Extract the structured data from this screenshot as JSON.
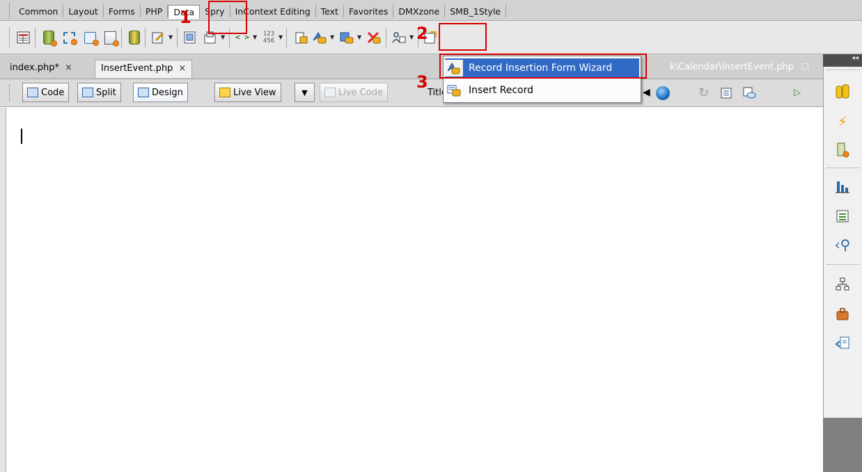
{
  "insert_bar": {
    "tabs": [
      {
        "label": "Common"
      },
      {
        "label": "Layout"
      },
      {
        "label": "Forms"
      },
      {
        "label": "PHP"
      },
      {
        "label": "Data",
        "active": true
      },
      {
        "label": "Spry"
      },
      {
        "label": "InContext Editing"
      },
      {
        "label": "Text"
      },
      {
        "label": "Favorites"
      },
      {
        "label": "DMXzone"
      },
      {
        "label": "SMB_1Style"
      }
    ],
    "icons": [
      "import-tabular-data-icon",
      "recordset-icon",
      "stored-procedure-icon",
      "dynamic-data-icon",
      "repeated-region-icon",
      "show-region-icon",
      "recordset-paging-icon",
      "go-to-detail-page-icon",
      "display-record-count-icon",
      "master-detail-icon",
      "insert-record-icon",
      "update-record-icon",
      "delete-record-icon",
      "user-authentication-icon",
      "xslt-transformation-icon"
    ],
    "code_glyph": "< >",
    "num_glyph_top": "123",
    "num_glyph_bottom": "456"
  },
  "documents": {
    "tabs": [
      {
        "label": "index.php*",
        "close": "×"
      },
      {
        "label": "InsertEvent.php",
        "close": "×",
        "active": true
      }
    ],
    "path": "k\\Calendar\\InsertEvent.php"
  },
  "doc_toolbar": {
    "code_label": "Code",
    "split_label": "Split",
    "design_label": "Design",
    "live_view_label": "Live View",
    "live_code_label": "Live Code",
    "title_label": "Title"
  },
  "insert_record_menu": {
    "items": [
      {
        "label": "Record Insertion Form Wizard",
        "highlighted": true
      },
      {
        "label": "Insert Record"
      }
    ]
  },
  "annotations": {
    "step1": "1",
    "step2": "2",
    "step3": "3",
    "color": "#d40000"
  },
  "colors": {
    "menu_highlight": "#316ac5",
    "dock_bg": "#7f7f7f"
  }
}
